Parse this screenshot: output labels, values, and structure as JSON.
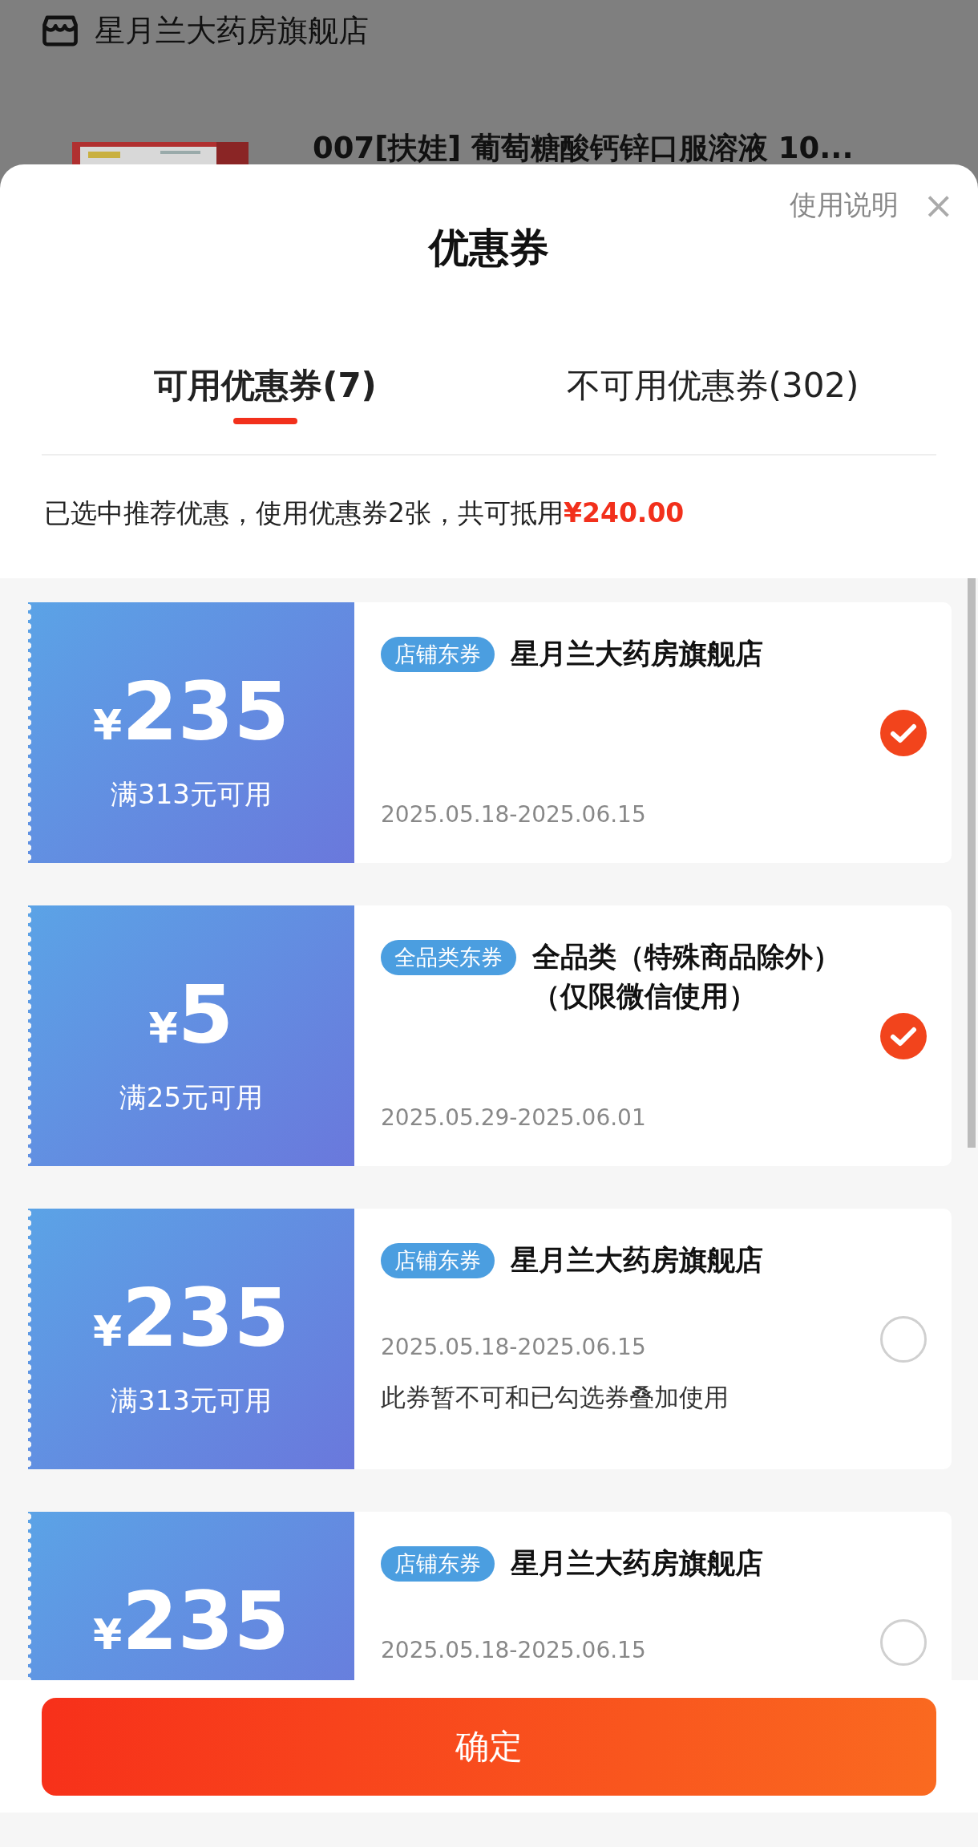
{
  "background_page": {
    "shop_name": "星月兰大药房旗舰店",
    "product": {
      "title": "007[扶娃] 葡萄糖酸钙锌口服溶液 10..."
    }
  },
  "sheet": {
    "title": "优惠券",
    "help_link": "使用说明",
    "close": "×"
  },
  "tabs": [
    {
      "label": "可用优惠券(7)",
      "selected": true
    },
    {
      "label": "不可用优惠券(302)",
      "selected": false
    }
  ],
  "summary": {
    "text": "已选中推荐优惠，使用优惠券2张，共可抵用",
    "amount": "¥240.00"
  },
  "coupons": [
    {
      "currency": "¥",
      "amount": "235",
      "condition": "满313元可用",
      "tag": "店铺东券",
      "title": "星月兰大药房旗舰店",
      "dates": "2025.05.18-2025.06.15",
      "selected": true
    },
    {
      "currency": "¥",
      "amount": "5",
      "condition": "满25元可用",
      "tag": "全品类东券",
      "title": "全品类（特殊商品除外）（仅限微信使用）",
      "dates": "2025.05.29-2025.06.01",
      "selected": true
    },
    {
      "currency": "¥",
      "amount": "235",
      "condition": "满313元可用",
      "tag": "店铺东券",
      "title": "星月兰大药房旗舰店",
      "dates": "2025.05.18-2025.06.15",
      "note": "此券暂不可和已勾选券叠加使用",
      "selected": false
    },
    {
      "currency": "¥",
      "amount": "235",
      "tag": "店铺东券",
      "title": "星月兰大药房旗舰店",
      "dates": "2025.05.18-2025.06.15",
      "selected": false
    }
  ],
  "confirm_button": "确定"
}
